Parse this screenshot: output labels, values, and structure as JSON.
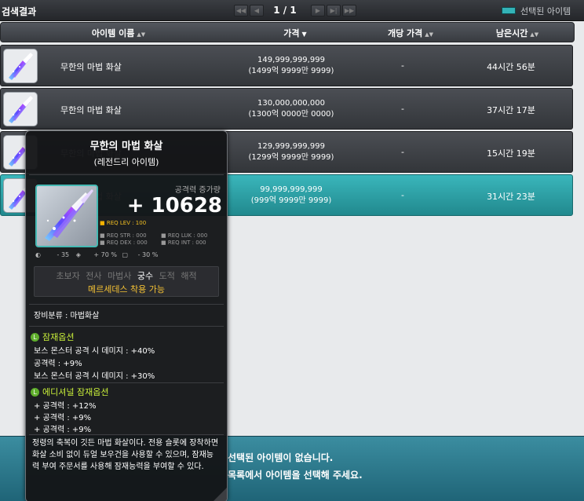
{
  "header": {
    "title": "검색결과",
    "page_label": "1 / 1",
    "legend_label": "선택된 아이템",
    "legend_color": "#33b3b7"
  },
  "pager": {
    "first_icon": "double-chevron-left-icon",
    "prev_icon": "chevron-left-icon",
    "next_icon": "chevron-right-icon",
    "last_icon": "skip-last-icon",
    "end_icon": "double-chevron-right-icon"
  },
  "columns": {
    "name": "아이템 이름",
    "price": "가격",
    "unit_price": "개당 가격",
    "time_left": "남은시간"
  },
  "rows": [
    {
      "name": "무한의 마법 화살",
      "price": "149,999,999,999",
      "price_kr": "(1499억 9999만 9999)",
      "unit_price": "-",
      "time_left": "44시간 56분",
      "selected": false
    },
    {
      "name": "무한의 마법 화살",
      "price": "130,000,000,000",
      "price_kr": "(1300억 0000만 0000)",
      "unit_price": "-",
      "time_left": "37시간 17분",
      "selected": false
    },
    {
      "name": "무한의 마법 화살",
      "price": "129,999,999,999",
      "price_kr": "(1299억 9999만 9999)",
      "unit_price": "-",
      "time_left": "15시간 19분",
      "selected": false
    },
    {
      "name": "무한의 마법 화살",
      "price": "99,999,999,999",
      "price_kr": "(999억 9999만 9999)",
      "unit_price": "-",
      "time_left": "31시간 23분",
      "selected": true
    }
  ],
  "bottom": {
    "message1": "선택된 아이템이 없습니다.",
    "message2": "목록에서 아이템을 선택해 주세요."
  },
  "tooltip": {
    "title": "무한의 마법 화살",
    "grade": "(레전드리 아이템)",
    "attack_label": "공격력 증가량",
    "attack_value": "+ 10628",
    "req_lev": "REQ LEV : 100",
    "req_str": "REQ STR : 000",
    "req_luk": "REQ LUK : 000",
    "req_dex": "REQ DEX : 000",
    "req_int": "REQ INT : 000",
    "stat1": "- 35",
    "stat2": "+ 70 %",
    "stat3": "- 30 %",
    "jobs": [
      "초보자",
      "전사",
      "마법사",
      "궁수",
      "도적",
      "해적"
    ],
    "active_job": "궁수",
    "mercedes": "메르세데스 착용 가능",
    "category": "장비분류 : 마법화살",
    "potential_title": "잠재옵션",
    "potential": [
      "보스 몬스터 공격 시 데미지 : +40%",
      "공격력 : +9%",
      "보스 몬스터 공격 시 데미지 : +30%"
    ],
    "additional_title": "에디셔널 잠재옵션",
    "additional": [
      "+ 공격력 : +12%",
      "+ 공격력 : +9%",
      "+ 공격력 : +9%"
    ],
    "description": "정령의 축복이 깃든 마법 화살이다. 전용 슬롯에 장착하면 화살 소비 없이 듀얼 보우건을 사용할 수 있으며, 잠재능력 부여 주문서를 사용해 잠재능력을 부여할 수 있다."
  }
}
